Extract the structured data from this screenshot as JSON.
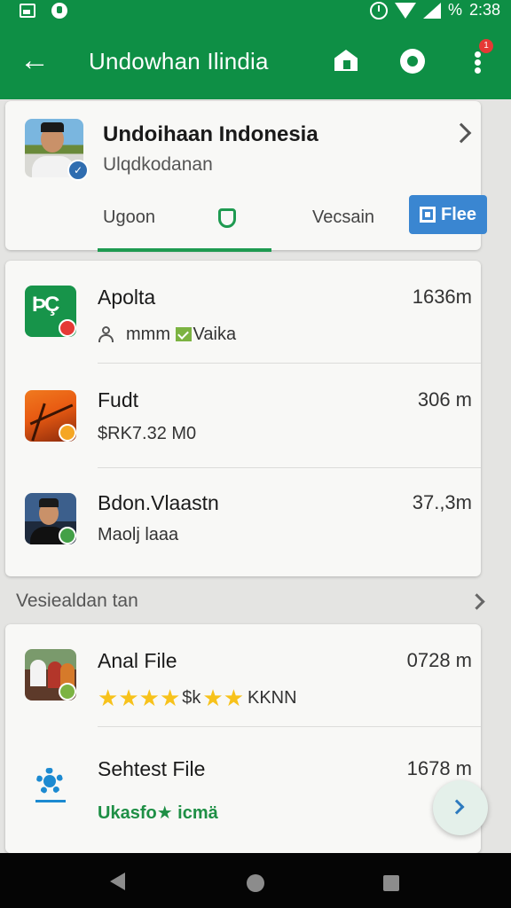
{
  "status_bar": {
    "battery": "%",
    "time": "2:38"
  },
  "app_bar": {
    "title": "Undowhan Ilindia",
    "badge": "1"
  },
  "profile": {
    "name": "Undoihaan Indonesia",
    "subtitle": "Ulqdkodanan",
    "tabs": [
      "Ugoon",
      "Vecsain"
    ],
    "files_button": "Flee"
  },
  "files": [
    {
      "name": "Apolta",
      "meta_text": "mmm",
      "meta_tag": "Vaika",
      "size": "1636m"
    },
    {
      "name": "Fudt",
      "meta": "$RK7.32 M0",
      "size": "306 m"
    },
    {
      "name": "Bdon.Vlaastn",
      "meta": "Maolj laaa",
      "size": "37.,3m"
    }
  ],
  "section": {
    "title": "Vesiealdan tan"
  },
  "more_files": [
    {
      "name": "Anal File",
      "rating": 4,
      "rating_text": "$k",
      "meta_text": "KKNN",
      "size": "0728 m"
    },
    {
      "name": "Sehtest File",
      "meta": "Ukasfo★ icmä",
      "size": "1678 m"
    }
  ],
  "colors": {
    "primary": "#0e8f45",
    "accent_blue": "#3a86d1",
    "star": "#f7c21b"
  }
}
